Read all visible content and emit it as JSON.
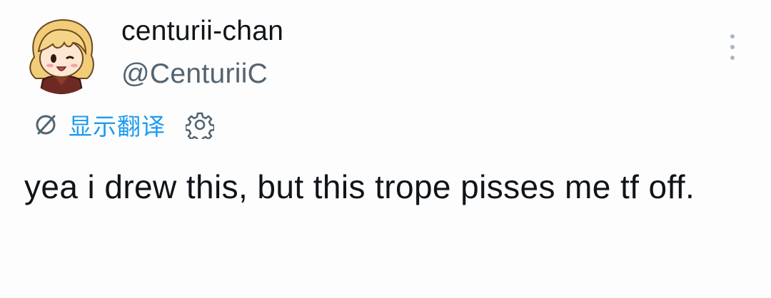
{
  "author": {
    "display_name": "centurii-chan",
    "handle": "@CenturiiC",
    "avatar_icon": "anime-girl-avatar"
  },
  "menu": {
    "icon": "more-vertical-icon"
  },
  "translation": {
    "label": "显示翻译",
    "icon": "translate-icon",
    "settings_icon": "gear-icon",
    "accent_color": "#1d9bf0"
  },
  "post": {
    "text": "yea i drew this, but this trope pisses me tf off."
  },
  "colors": {
    "text_primary": "#0f1419",
    "text_secondary": "#536471",
    "background": "#fdfdfd"
  }
}
